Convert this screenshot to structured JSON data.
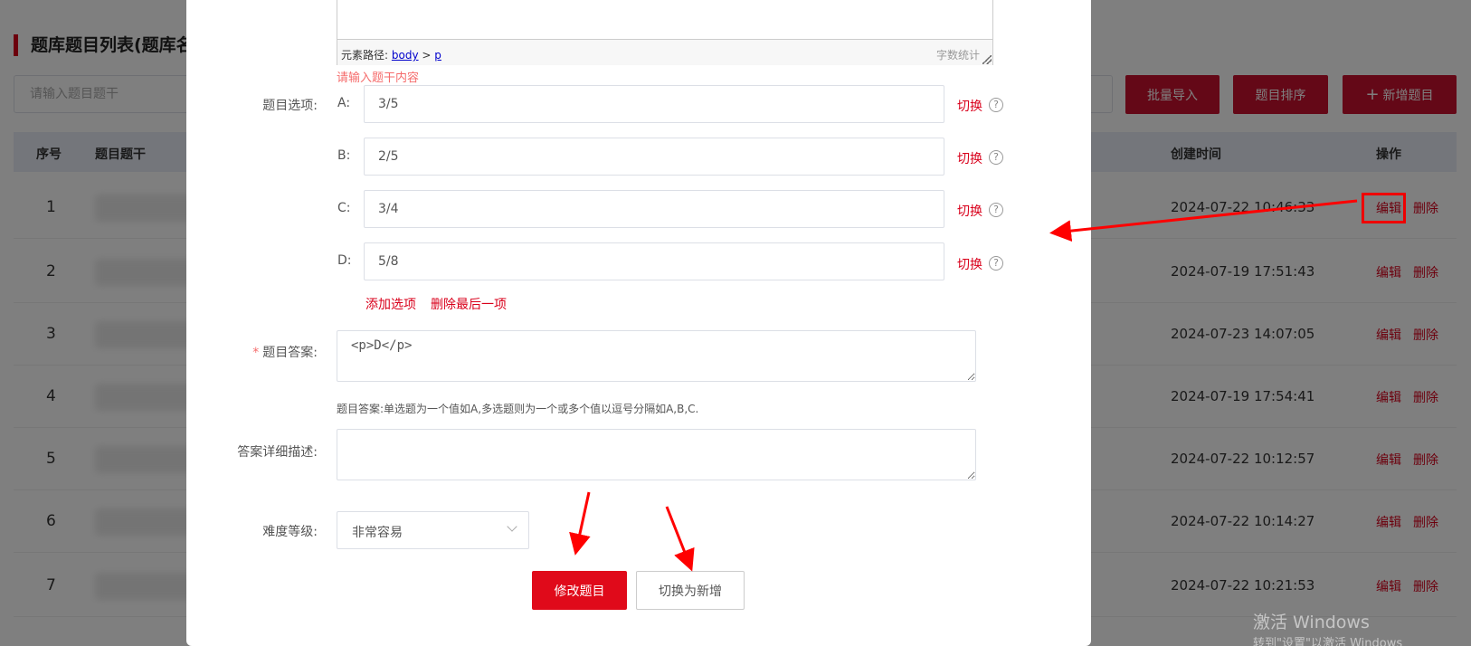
{
  "background": {
    "title": "题库题目列表(题库名",
    "search_placeholder": "请输入题目题干",
    "buttons": {
      "batch_import": "批量导入",
      "sort": "题目排序",
      "add": "新增题目",
      "add_icon": "plus-icon"
    },
    "headers": {
      "index": "序号",
      "stem": "题目题干",
      "created": "创建时间",
      "actions": "操作"
    },
    "rows": [
      {
        "index": "1",
        "created": "2024-07-22 10:46:33",
        "edit": "编辑",
        "delete": "删除"
      },
      {
        "index": "2",
        "created": "2024-07-19 17:51:43",
        "edit": "编辑",
        "delete": "删除"
      },
      {
        "index": "3",
        "created": "2024-07-23 14:07:05",
        "edit": "编辑",
        "delete": "删除"
      },
      {
        "index": "4",
        "created": "2024-07-19 17:54:41",
        "edit": "编辑",
        "delete": "删除"
      },
      {
        "index": "5",
        "created": "2024-07-22 10:12:57",
        "edit": "编辑",
        "delete": "删除"
      },
      {
        "index": "6",
        "created": "2024-07-22 10:14:27",
        "edit": "编辑",
        "delete": "删除"
      },
      {
        "index": "7",
        "created": "2024-07-22 10:21:53",
        "edit": "编辑",
        "delete": "删除"
      }
    ]
  },
  "dialog": {
    "editor": {
      "path_label": "元素路径:",
      "path_body": "body",
      "path_sep": ">",
      "path_p": "p",
      "count_label": "字数统计"
    },
    "error_text": "请输入题干内容",
    "options_label": "题目选项:",
    "options": [
      {
        "key": "A:",
        "value": "3/5",
        "switch": "切换",
        "help_icon": "question-circle-icon"
      },
      {
        "key": "B:",
        "value": "2/5",
        "switch": "切换",
        "help_icon": "question-circle-icon"
      },
      {
        "key": "C:",
        "value": "3/4",
        "switch": "切换",
        "help_icon": "question-circle-icon"
      },
      {
        "key": "D:",
        "value": "5/8",
        "switch": "切换",
        "help_icon": "question-circle-icon"
      }
    ],
    "add_option": "添加选项",
    "delete_last": "删除最后一项",
    "answer_required_mark": "*",
    "answer_label": "题目答案:",
    "answer_value": "<p>D</p>",
    "answer_hint": "题目答案:单选题为一个值如A,多选题则为一个或多个值以逗号分隔如A,B,C.",
    "desc_label": "答案详细描述:",
    "desc_value": "",
    "difficulty_label": "难度等级:",
    "difficulty_value": "非常容易",
    "submit": "修改题目",
    "switch_new": "切换为新增"
  },
  "watermark": {
    "line1": "激活 Windows",
    "line2": "转到\"设置\"以激活 Windows"
  },
  "colors": {
    "accent": "#d9001b",
    "button_red": "#c8102e",
    "error": "#f56c6c",
    "annotation": "#ff0000"
  }
}
